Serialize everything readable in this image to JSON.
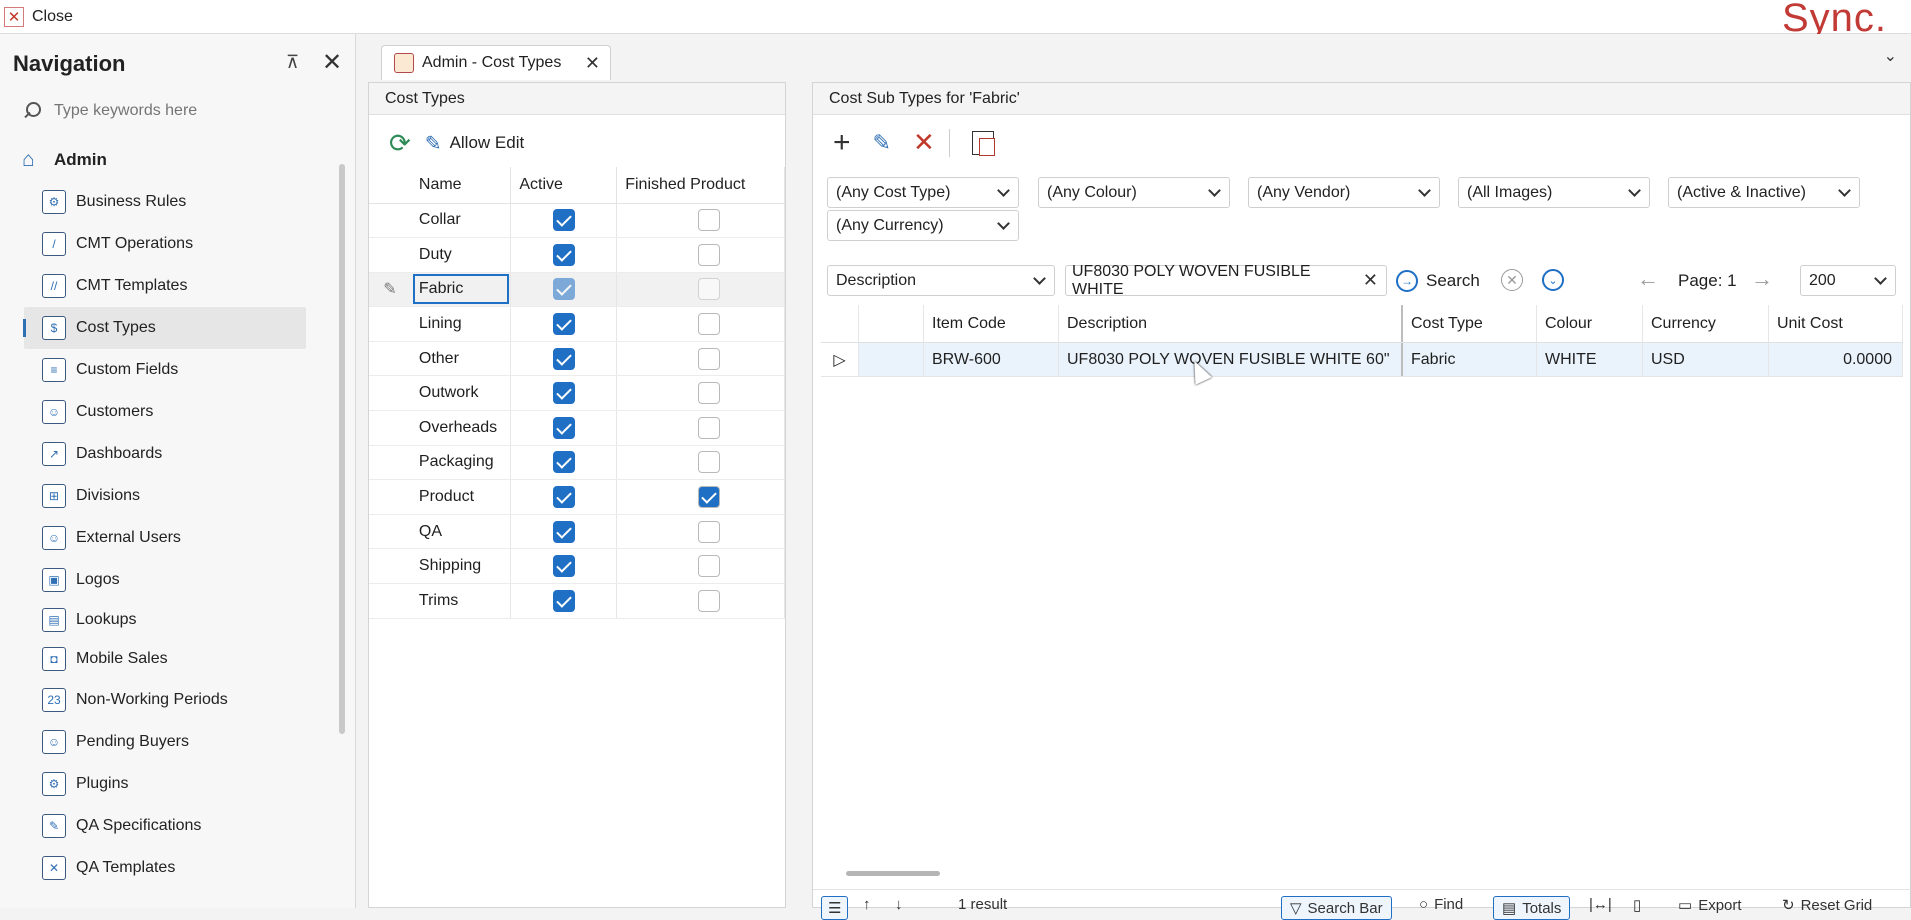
{
  "window": {
    "close_label": "Close",
    "brand": "Sync."
  },
  "navigation": {
    "title": "Navigation",
    "search_placeholder": "Type keywords here",
    "root_label": "Admin",
    "items": [
      {
        "label": "Business Rules",
        "icon": "gear-icon"
      },
      {
        "label": "CMT Operations",
        "icon": "ruler-icon"
      },
      {
        "label": "CMT Templates",
        "icon": "ruler-stack-icon"
      },
      {
        "label": "Cost Types",
        "icon": "cost-types-icon",
        "selected": true
      },
      {
        "label": "Custom Fields",
        "icon": "fields-icon"
      },
      {
        "label": "Customers",
        "icon": "customer-icon"
      },
      {
        "label": "Dashboards",
        "icon": "dashboard-icon"
      },
      {
        "label": "Divisions",
        "icon": "divisions-icon"
      },
      {
        "label": "External Users",
        "icon": "external-users-icon"
      },
      {
        "label": "Logos",
        "icon": "logo-icon"
      },
      {
        "label": "Lookups",
        "icon": "lookup-icon"
      },
      {
        "label": "Mobile Sales",
        "icon": "mobile-sales-icon"
      },
      {
        "label": "Non-Working Periods",
        "icon": "calendar-icon"
      },
      {
        "label": "Pending Buyers",
        "icon": "pending-buyers-icon"
      },
      {
        "label": "Plugins",
        "icon": "plugin-icon"
      },
      {
        "label": "QA Specifications",
        "icon": "qa-spec-icon"
      },
      {
        "label": "QA Templates",
        "icon": "qa-template-icon"
      }
    ]
  },
  "tab": {
    "label": "Admin - Cost Types"
  },
  "cost_types": {
    "header": "Cost Types",
    "allow_edit_label": "Allow Edit",
    "columns": [
      "Name",
      "Active",
      "Finished Product"
    ],
    "rows": [
      {
        "name": "Collar",
        "active": true,
        "finished": false
      },
      {
        "name": "Duty",
        "active": true,
        "finished": false
      },
      {
        "name": "Fabric",
        "active": true,
        "finished": false,
        "current": true
      },
      {
        "name": "Lining",
        "active": true,
        "finished": false
      },
      {
        "name": "Other",
        "active": true,
        "finished": false
      },
      {
        "name": "Outwork",
        "active": true,
        "finished": false
      },
      {
        "name": "Overheads",
        "active": true,
        "finished": false
      },
      {
        "name": "Packaging",
        "active": true,
        "finished": false
      },
      {
        "name": "Product",
        "active": true,
        "finished": true
      },
      {
        "name": "QA",
        "active": true,
        "finished": false
      },
      {
        "name": "Shipping",
        "active": true,
        "finished": false
      },
      {
        "name": "Trims",
        "active": true,
        "finished": false
      }
    ]
  },
  "sub_types": {
    "header": "Cost Sub Types for 'Fabric'",
    "filters": {
      "cost_type": "(Any Cost Type)",
      "colour": "(Any Colour)",
      "vendor": "(Any Vendor)",
      "images": "(All Images)",
      "status": "(Active & Inactive)",
      "currency": "(Any Currency)"
    },
    "search_field": "Description",
    "search_value": "UF8030 POLY WOVEN FUSIBLE WHITE",
    "search_label": "Search",
    "page_label": "Page: 1",
    "page_size": "200",
    "columns": [
      "Item Code",
      "Description",
      "Cost Type",
      "Colour",
      "Currency",
      "Unit Cost"
    ],
    "rows": [
      {
        "item_code": "BRW-600",
        "description": "UF8030 POLY WOVEN FUSIBLE WHITE 60\"",
        "cost_type": "Fabric",
        "colour": "WHITE",
        "currency": "USD",
        "unit_cost": "0.0000"
      }
    ],
    "status_bar": {
      "result_count": "1 result",
      "search_bar": "Search Bar",
      "find": "Find",
      "totals": "Totals",
      "export": "Export",
      "reset_grid": "Reset Grid"
    }
  }
}
